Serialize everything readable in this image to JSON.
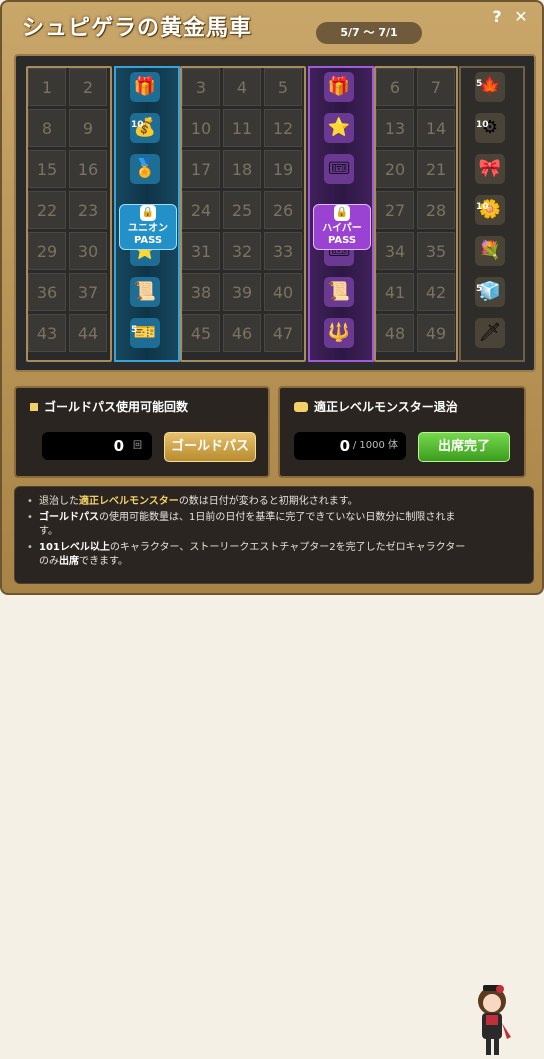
{
  "window": {
    "title": "シュピゲラの黄金馬車",
    "date_range": "5/7 ～ 7/1",
    "help_icon": "?",
    "close_icon": "✕"
  },
  "board": {
    "numbers_left": [
      [
        "1",
        "2"
      ],
      [
        "8",
        "9"
      ],
      [
        "15",
        "16"
      ],
      [
        "22",
        "23"
      ],
      [
        "29",
        "30"
      ],
      [
        "36",
        "37"
      ],
      [
        "43",
        "44"
      ]
    ],
    "numbers_mid": [
      [
        "3",
        "4",
        "5"
      ],
      [
        "10",
        "11",
        "12"
      ],
      [
        "17",
        "18",
        "19"
      ],
      [
        "24",
        "25",
        "26"
      ],
      [
        "31",
        "32",
        "33"
      ],
      [
        "38",
        "39",
        "40"
      ],
      [
        "45",
        "46",
        "47"
      ]
    ],
    "numbers_right": [
      [
        "6",
        "7"
      ],
      [
        "13",
        "14"
      ],
      [
        "20",
        "21"
      ],
      [
        "27",
        "28"
      ],
      [
        "34",
        "35"
      ],
      [
        "41",
        "42"
      ],
      [
        "48",
        "49"
      ]
    ],
    "union_lock": {
      "line1": "ユニオン",
      "line2": "PASS"
    },
    "hyper_lock": {
      "line1": "ハイパー",
      "line2": "PASS"
    },
    "union_counts": [
      "",
      "10",
      "",
      "",
      "",
      "",
      "5"
    ],
    "hyper_counts": [
      "",
      "",
      "",
      "",
      "",
      "",
      ""
    ],
    "reward_counts": [
      "5",
      "10",
      "",
      "10",
      "",
      "5",
      ""
    ],
    "icons": {
      "union": [
        "chest-icon",
        "coin-bag-icon",
        "medal-icon",
        "lock-icon",
        "exp-icon",
        "scroll-icon",
        "ticket-icon"
      ],
      "hyper": [
        "pink-chest-icon",
        "exp-icon",
        "coupon-icon",
        "lock-icon",
        "coupon-icon",
        "scroll-icon",
        "staff-icon"
      ],
      "reward": [
        "maple-leaf-icon",
        "gear-icon",
        "gift-box-icon",
        "flower-icon",
        "bouquet-icon",
        "cube-icon",
        "sword-icon"
      ]
    }
  },
  "gold_pass": {
    "title": "ゴールドパス使用可能回数",
    "value": "0",
    "unit": "回",
    "button": "ゴールドパス"
  },
  "monster": {
    "title": "適正レベルモンスター退治",
    "value": "0",
    "suffix": "/ 1000 体",
    "button": "出席完了"
  },
  "info": {
    "line1_pre": "退治した",
    "line1_hl": "適正レベルモンスター",
    "line1_post": "の数は日付が変わると初期化されます。",
    "line2_hl": "ゴールドパス",
    "line2_post": "の使用可能数量は、1日前の日付を基準に完了できていない日数分に制限されます。",
    "line3_hl": "101レベル以上",
    "line3_mid": "のキャラクター、ストーリークエストチャプター2を完了したゼロキャラクターのみ",
    "line3_hl2": "出席",
    "line3_post": "できます。"
  }
}
